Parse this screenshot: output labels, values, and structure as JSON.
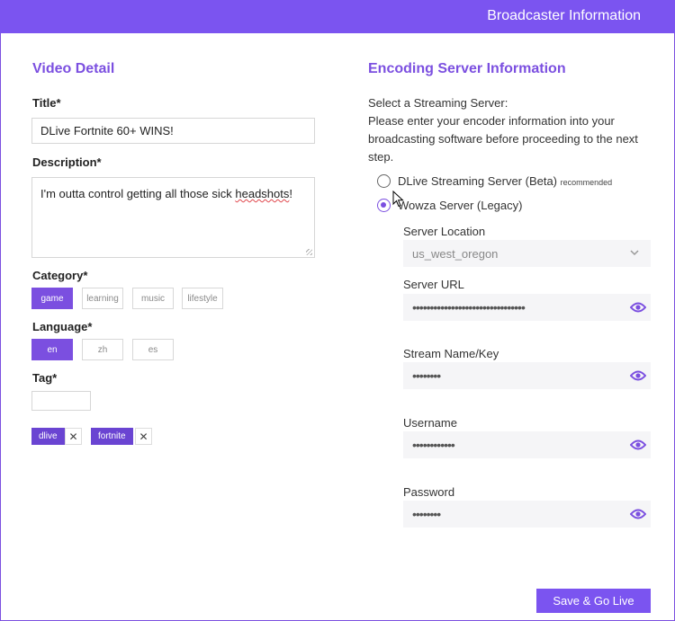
{
  "header": {
    "title": "Broadcaster Information"
  },
  "video_detail": {
    "heading": "Video Detail",
    "title_label": "Title*",
    "title_value": "DLive Fortnite 60+ WINS!",
    "description_label": "Description*",
    "description_before": "I'm outta control getting all those sick ",
    "description_misspelled": "headshots",
    "description_after": "!",
    "category_label": "Category*",
    "categories": [
      "game",
      "learning",
      "music",
      "lifestyle"
    ],
    "category_selected": "game",
    "language_label": "Language*",
    "languages": [
      "en",
      "zh",
      "es"
    ],
    "language_selected": "en",
    "tag_label": "Tag*",
    "tag_input_value": "",
    "tags": [
      "dlive",
      "fortnite"
    ],
    "tag_remove_glyph": "✕"
  },
  "encoding": {
    "heading": "Encoding Server Information",
    "select_prompt": "Select a Streaming Server:",
    "instructions_line1": "Please enter your encoder information into your",
    "instructions_line2": "broadcasting software before proceeding to the next",
    "instructions_line3": "step.",
    "server_option_1": "DLive Streaming Server (Beta)",
    "server_option_1_badge": "recommended",
    "server_option_2": "Wowza Server (Legacy)",
    "selected_server": "Wowza Server (Legacy)",
    "location_label": "Server Location",
    "location_value": "us_west_oregon",
    "url_label": "Server URL",
    "url_value": "••••••••••••••••••••••••••••••••",
    "key_label": "Stream Name/Key",
    "key_value": "••••••••",
    "username_label": "Username",
    "username_value": "••••••••••••",
    "password_label": "Password",
    "password_value": "••••••••"
  },
  "actions": {
    "go_live": "Save & Go Live"
  },
  "colors": {
    "accent": "#7b54f0",
    "accent_dark": "#6a44d2",
    "spellcheck": "#e0474c"
  },
  "icons": [
    "eye-icon",
    "chevron-down-icon",
    "close-icon",
    "mouse-cursor-icon",
    "resize-handle-icon"
  ]
}
